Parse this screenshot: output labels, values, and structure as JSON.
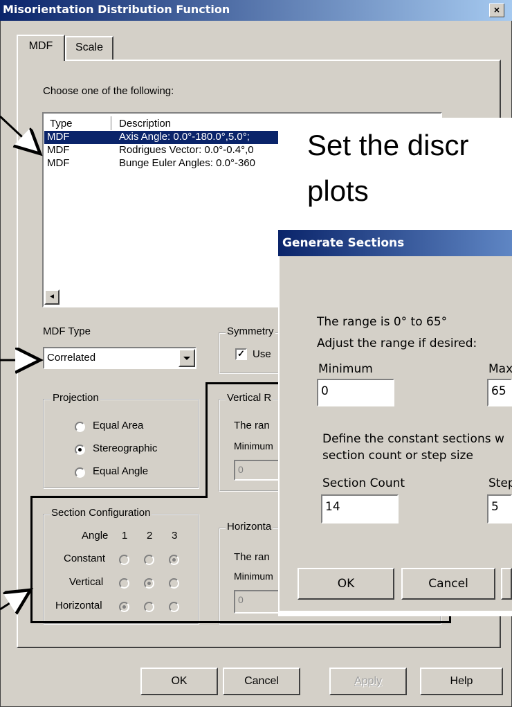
{
  "window": {
    "title": "Misorientation Distribution Function",
    "close": "×"
  },
  "tabs": [
    "MDF",
    "Scale"
  ],
  "main": {
    "choose_label": "Choose one of the following:",
    "table": {
      "headers": [
        "Type",
        "Description"
      ],
      "rows": [
        [
          "MDF",
          "Axis Angle: 0.0°-180.0°,5.0°;"
        ],
        [
          "MDF",
          "Rodrigues Vector: 0.0°-0.4°,0"
        ],
        [
          "MDF",
          "Bunge Euler Angles: 0.0°-360"
        ]
      ],
      "scroll_left": "◄"
    },
    "mdf_type": {
      "label": "MDF Type",
      "value": "Correlated"
    },
    "symmetry": {
      "label": "Symmetry",
      "checkbox_label": "Use",
      "checked": "✓"
    },
    "projection": {
      "label": "Projection",
      "options": [
        "Equal Area",
        "Stereographic",
        "Equal Angle"
      ],
      "selected": 1
    },
    "vertical_range": {
      "label": "Vertical R",
      "range_text": "The ran",
      "min_label": "Minimum",
      "min_value": "0"
    },
    "horizontal_range": {
      "label": "Horizonta",
      "range_text": "The ran",
      "min_label": "Minimum",
      "min_value": "0"
    },
    "section_config": {
      "label": "Section Configuration",
      "angle_label": "Angle",
      "columns": [
        "1",
        "2",
        "3"
      ],
      "rows": [
        "Constant",
        "Vertical",
        "Horizontal"
      ],
      "selected": [
        3,
        2,
        1
      ]
    }
  },
  "buttons": {
    "ok": "OK",
    "cancel": "Cancel",
    "apply": "Apply",
    "help": "Help"
  },
  "overlay": {
    "heading_line1": "Set the discr",
    "heading_line2": "plots",
    "dialog": {
      "title": "Generate Sections",
      "range_text": "The range is 0° to 65°",
      "adjust_text": "Adjust the range if desired:",
      "min_label": "Minimum",
      "min_value": "0",
      "max_label": "Max",
      "max_value": "65",
      "define_line1": "Define the constant sections w",
      "define_line2": "section count or step size",
      "count_label": "Section Count",
      "count_value": "14",
      "step_label": "Step",
      "step_value": "5",
      "ok": "OK",
      "cancel": "Cancel"
    }
  }
}
